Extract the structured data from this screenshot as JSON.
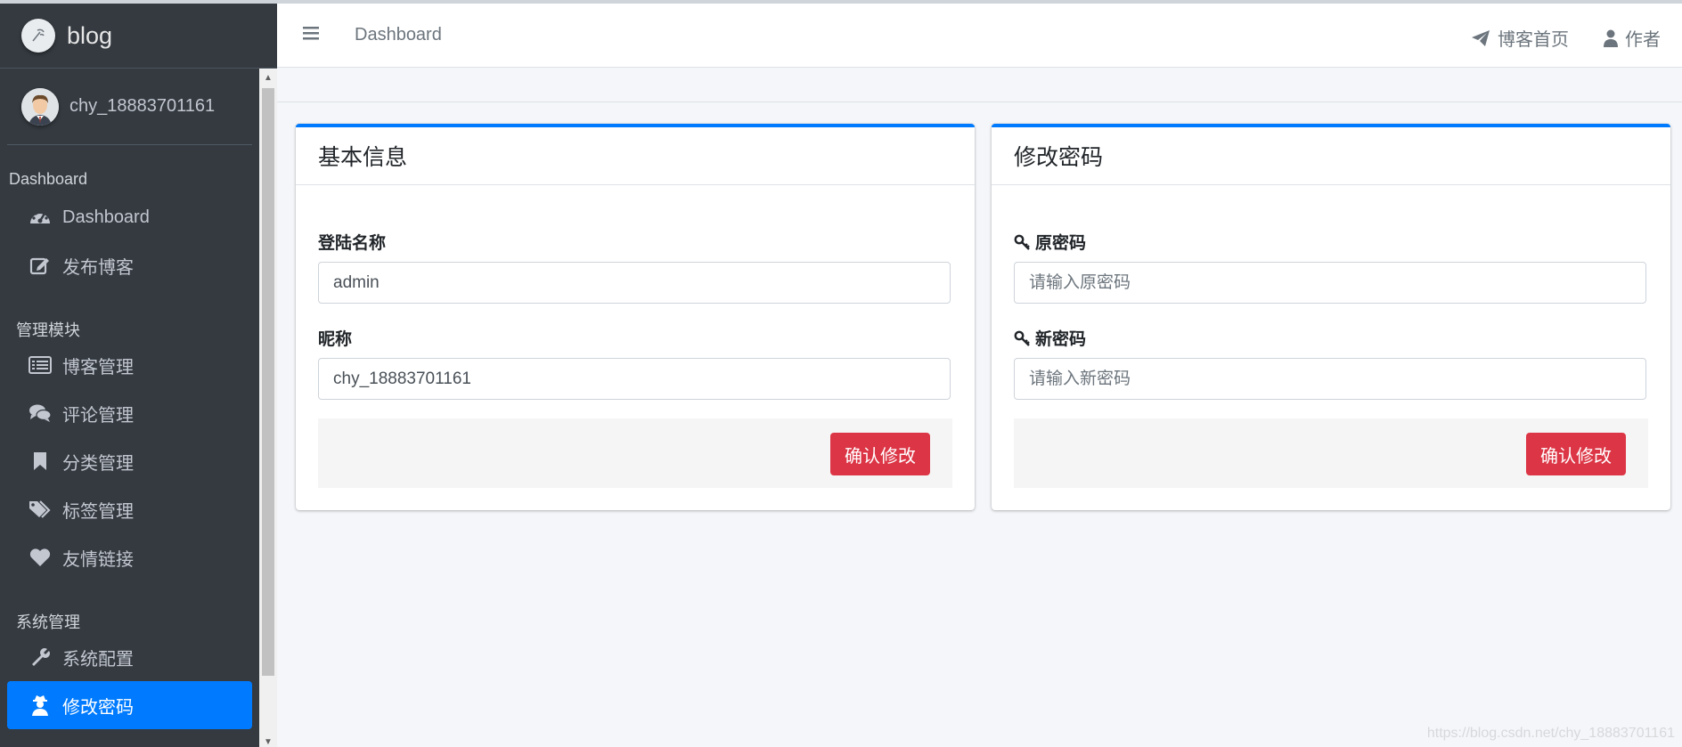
{
  "brand": {
    "name": "blog"
  },
  "user": {
    "name": "chy_18883701161"
  },
  "sidebar": {
    "sections": [
      {
        "header": "Dashboard",
        "items": [
          {
            "label": "Dashboard",
            "icon": "tachometer-icon"
          },
          {
            "label": "发布博客",
            "icon": "edit-icon"
          }
        ]
      },
      {
        "header": "管理模块",
        "items": [
          {
            "label": "博客管理",
            "icon": "list-icon"
          },
          {
            "label": "评论管理",
            "icon": "comments-icon"
          },
          {
            "label": "分类管理",
            "icon": "bookmark-icon"
          },
          {
            "label": "标签管理",
            "icon": "tags-icon"
          },
          {
            "label": "友情链接",
            "icon": "heart-icon"
          }
        ]
      },
      {
        "header": "系统管理",
        "items": [
          {
            "label": "系统配置",
            "icon": "wrench-icon"
          },
          {
            "label": "修改密码",
            "icon": "user-secret-icon",
            "active": true
          }
        ]
      }
    ]
  },
  "navbar": {
    "breadcrumb": "Dashboard",
    "links": [
      {
        "label": "博客首页",
        "icon": "paper-plane-icon"
      },
      {
        "label": "作者",
        "icon": "user-icon"
      }
    ]
  },
  "basic_info": {
    "title": "基本信息",
    "login_name_label": "登陆名称",
    "login_name_value": "admin",
    "nickname_label": "昵称",
    "nickname_value": "chy_18883701161",
    "submit_label": "确认修改"
  },
  "password": {
    "title": "修改密码",
    "old_label": "原密码",
    "old_placeholder": "请输入原密码",
    "new_label": "新密码",
    "new_placeholder": "请输入新密码",
    "submit_label": "确认修改"
  },
  "watermark": "https://blog.csdn.net/chy_18883701161",
  "colors": {
    "sidebar_bg": "#343a40",
    "accent": "#007bff",
    "danger": "#dc3545",
    "content_bg": "#f4f6f9"
  }
}
